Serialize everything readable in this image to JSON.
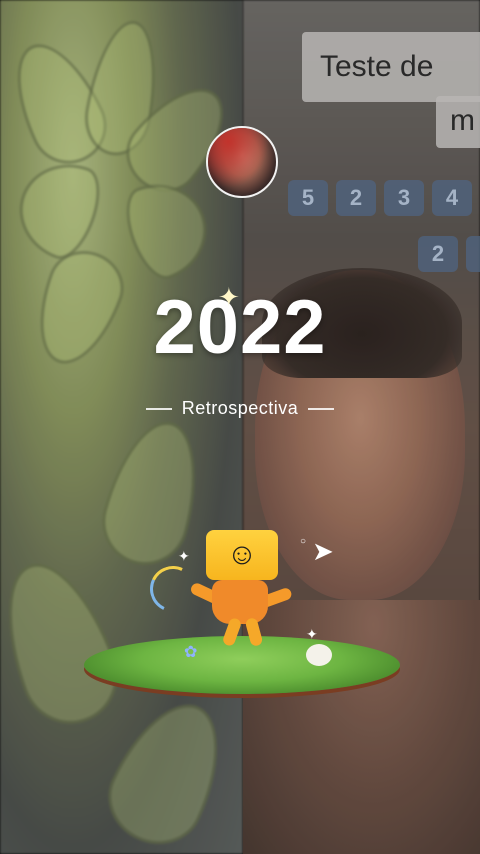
{
  "header": {
    "year": "2022",
    "subtitle": "Retrospectiva"
  },
  "background_left": {
    "description_icon": "flower-drawing"
  },
  "background_right": {
    "speech_line1": "Teste de",
    "speech_line2": "m",
    "number_row1": [
      "5",
      "2",
      "3",
      "4"
    ],
    "number_row2": [
      "2"
    ]
  },
  "avatar": {
    "icon": "profile-avatar"
  },
  "illustration": {
    "icons": [
      "smiley-mascot-icon",
      "paper-plane-icon",
      "sparkle-icon",
      "grass-island"
    ]
  },
  "colors": {
    "text": "#ffffff",
    "mascot_yellow": "#ffd23f",
    "mascot_orange": "#f08a2a",
    "grass": "#6db542"
  }
}
